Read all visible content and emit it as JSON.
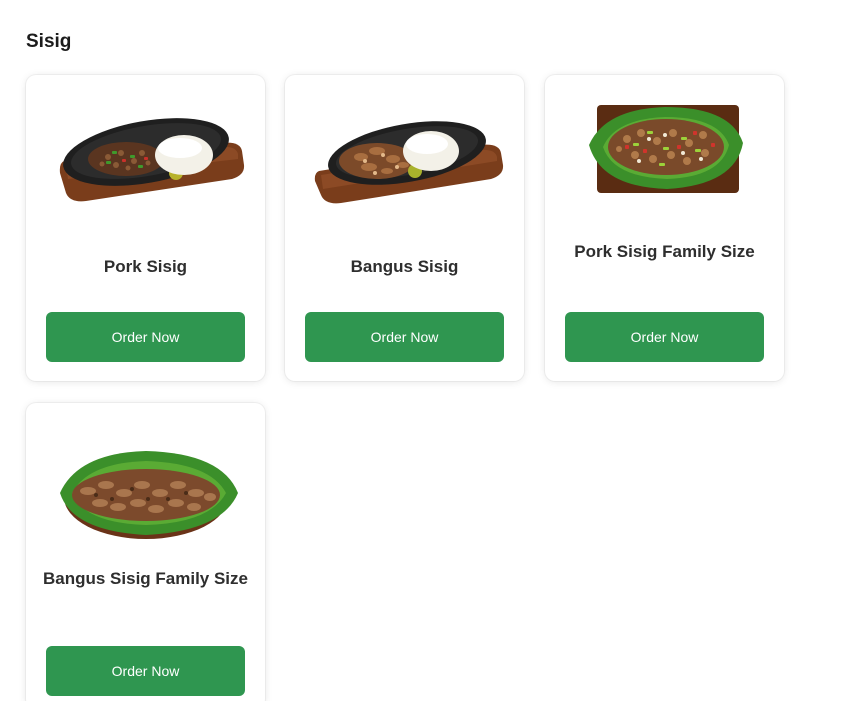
{
  "section": {
    "title": "Sisig"
  },
  "items": [
    {
      "name": "Pork Sisig",
      "button_label": "Order Now",
      "image": "pork-sisig-image"
    },
    {
      "name": "Bangus Sisig",
      "button_label": "Order Now",
      "image": "bangus-sisig-image"
    },
    {
      "name": "Pork Sisig Family Size",
      "button_label": "Order Now",
      "image": "pork-sisig-family-image"
    },
    {
      "name": "Bangus Sisig Family Size",
      "button_label": "Order Now",
      "image": "bangus-sisig-family-image"
    }
  ],
  "colors": {
    "button": "#2f9650",
    "button_text": "#ffffff",
    "title_text": "#1c1c1c"
  }
}
